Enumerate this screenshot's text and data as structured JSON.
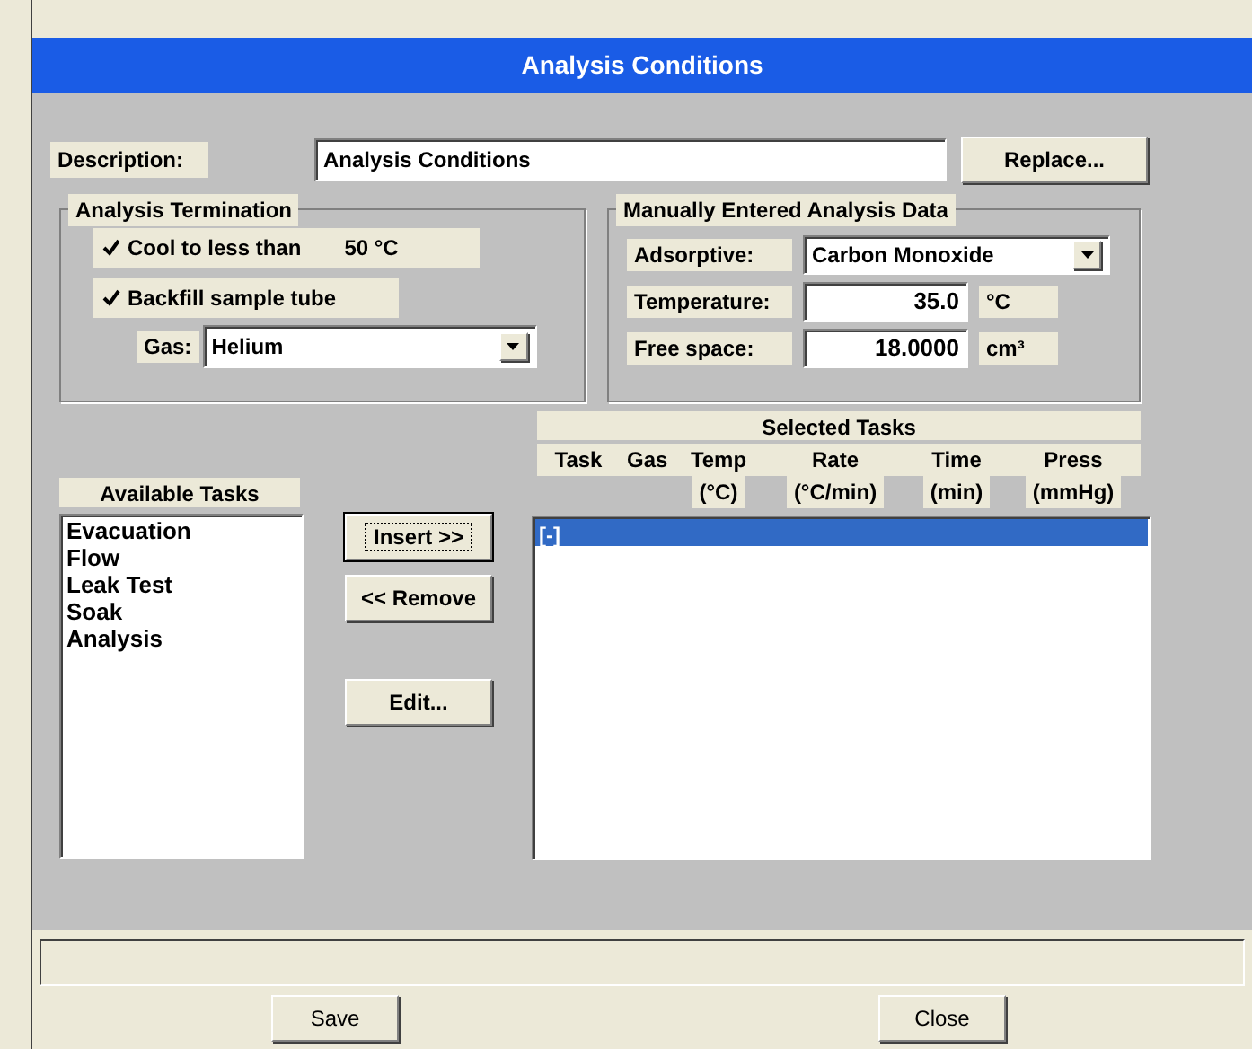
{
  "window": {
    "title": "Analysis Conditions"
  },
  "description": {
    "label": "Description:",
    "value": "Analysis Conditions"
  },
  "replace_button": "Replace...",
  "termination": {
    "title": "Analysis Termination",
    "cool": {
      "label": "Cool to less than",
      "checked": true,
      "value": "50 °C"
    },
    "backfill": {
      "label": "Backfill sample tube",
      "checked": true
    },
    "gas": {
      "label": "Gas:",
      "value": "Helium"
    }
  },
  "manual": {
    "title": "Manually Entered Analysis Data",
    "fields": [
      {
        "kind": "dropdown",
        "label": "Adsorptive:",
        "value": "Carbon Monoxide"
      },
      {
        "kind": "input",
        "label": "Temperature:",
        "value": "35.0",
        "unit": "°C"
      },
      {
        "kind": "input",
        "label": "Free space:",
        "value": "18.0000",
        "unit": "cm³"
      }
    ]
  },
  "available_tasks": {
    "label": "Available Tasks",
    "items": [
      "Evacuation",
      "Flow",
      "Leak Test",
      "Soak",
      "Analysis"
    ]
  },
  "task_buttons": [
    {
      "label": "Insert >>",
      "focused": true
    },
    {
      "label": "<< Remove",
      "focused": false
    },
    {
      "label": "Edit...",
      "focused": false
    }
  ],
  "selected_tasks": {
    "title": "Selected Tasks",
    "columns": [
      {
        "title": "Task"
      },
      {
        "title": "Gas"
      },
      {
        "title": "Temp",
        "unit": "(°C)"
      },
      {
        "title": "Rate",
        "unit": "(°C/min)"
      },
      {
        "title": "Time",
        "unit": "(min)"
      },
      {
        "title": "Press",
        "unit": "(mmHg)"
      }
    ],
    "rows": [
      {
        "text": "[-]",
        "selected": true
      }
    ]
  },
  "footer_buttons": [
    "Save",
    "Close"
  ]
}
